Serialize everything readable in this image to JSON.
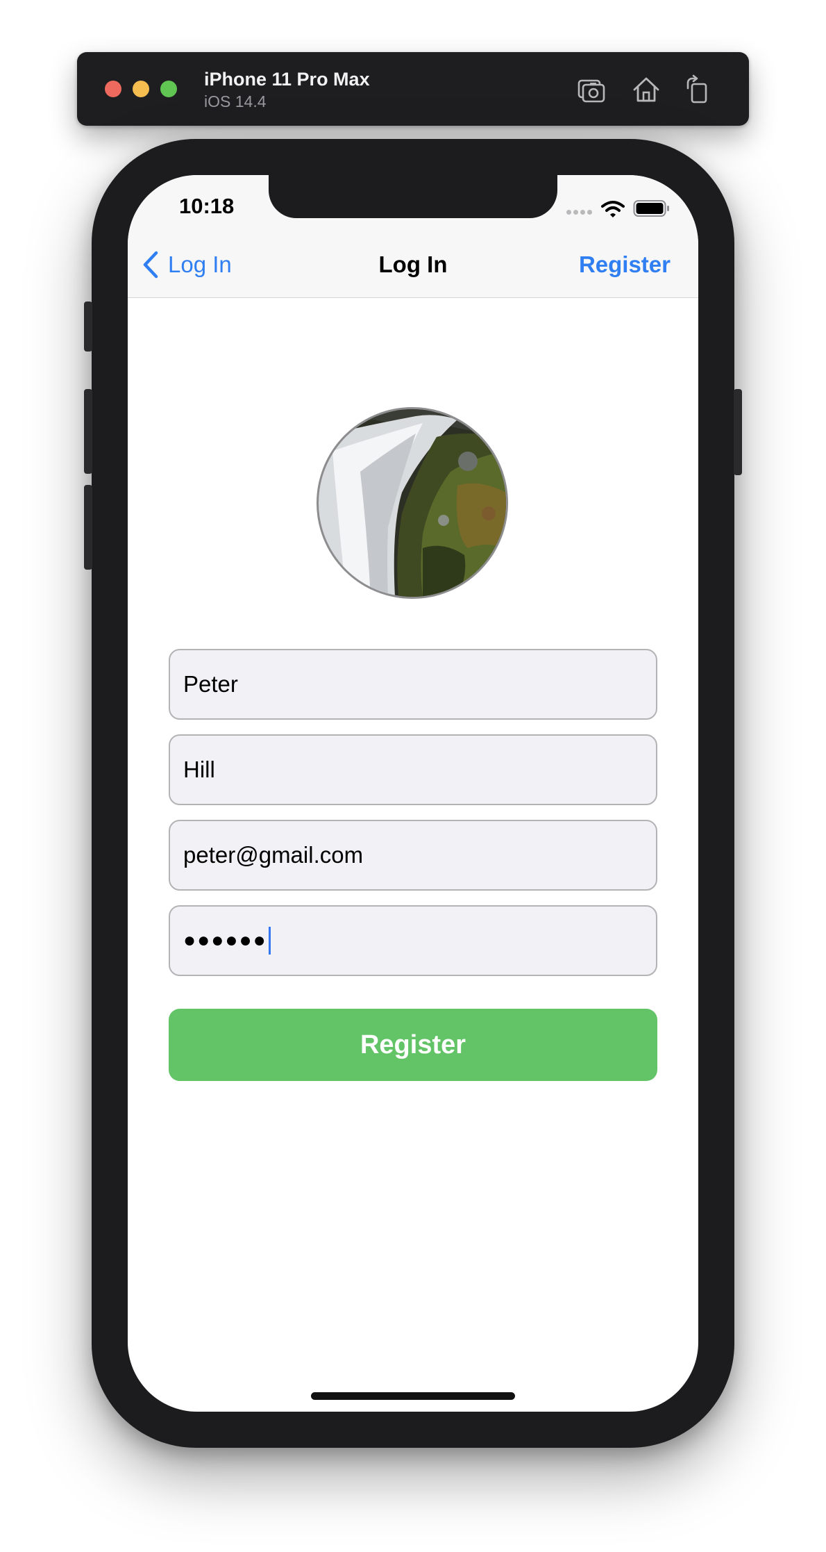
{
  "simulator": {
    "device_name": "iPhone 11 Pro Max",
    "os_version": "iOS 14.4",
    "toolbar_icons": [
      "screenshot-icon",
      "home-icon",
      "rotate-icon"
    ]
  },
  "status_bar": {
    "time": "10:18",
    "icons": [
      "cellular-signal-icon",
      "wifi-icon",
      "battery-icon"
    ]
  },
  "nav_bar": {
    "back_label": "Log In",
    "title": "Log In",
    "right_button_label": "Register"
  },
  "avatar": {
    "description_icon": "waterfall-photo"
  },
  "form": {
    "first_name": "Peter",
    "last_name": "Hill",
    "email": "peter@gmail.com",
    "password_mask": "●●●●●●",
    "register_label": "Register"
  },
  "colors": {
    "accent": "#2f7ff2",
    "register_button": "#63c467",
    "field_background": "#f2f2f6"
  }
}
